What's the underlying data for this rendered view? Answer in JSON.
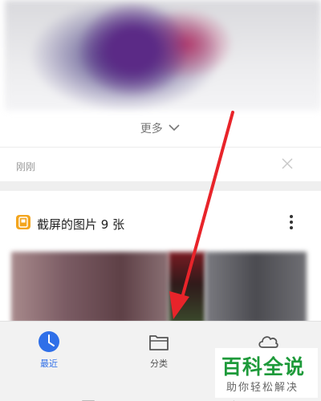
{
  "top_card": {
    "more_label": "更多",
    "time_label": "刚刚"
  },
  "album": {
    "title": "截屏的图片 9 张"
  },
  "nav": {
    "items": [
      {
        "label": "最近",
        "icon": "clock-icon",
        "active": true
      },
      {
        "label": "分类",
        "icon": "folder-icon",
        "active": false
      },
      {
        "label": "",
        "icon": "cloud-icon",
        "active": false
      }
    ]
  },
  "watermark": {
    "title": "百科全说",
    "subtitle": "助你轻松解决"
  },
  "colors": {
    "active": "#2f6fe8",
    "arrow": "#e8242a",
    "watermark_green": "#1e9a3a"
  }
}
